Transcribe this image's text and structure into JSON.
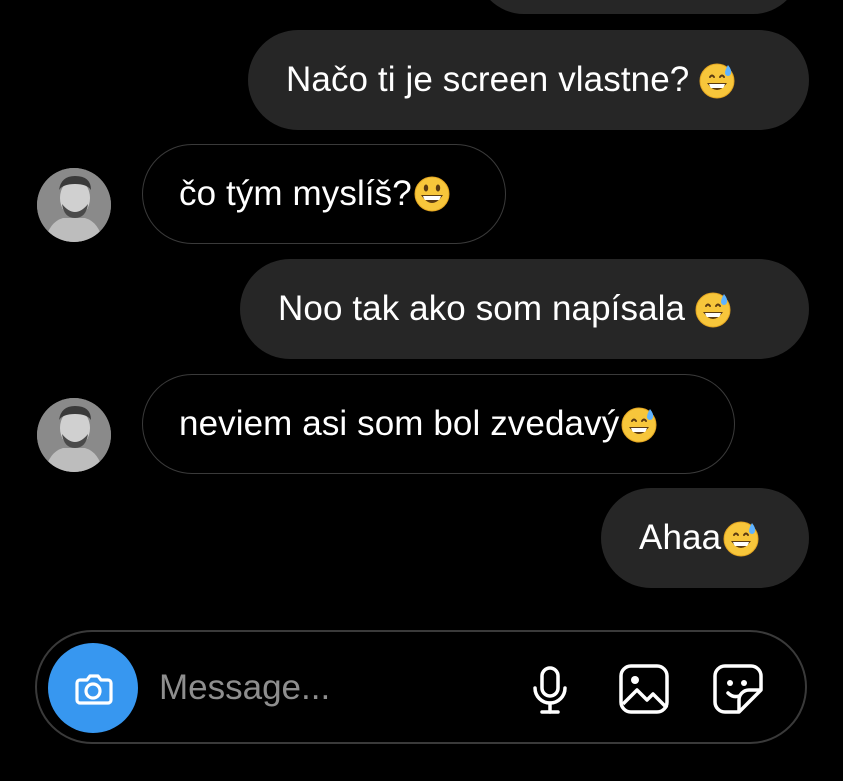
{
  "messages": [
    {
      "side": "sent",
      "text": ""
    },
    {
      "side": "sent",
      "text": "Načo ti je screen vlastne?",
      "emoji": "grinning-sweat-emoji"
    },
    {
      "side": "received",
      "text": "čo tým myslíš?",
      "emoji": "grinning-emoji"
    },
    {
      "side": "sent",
      "text": "Noo tak ako som napísala",
      "emoji": "grinning-sweat-emoji"
    },
    {
      "side": "received",
      "text": "neviem asi som bol zvedavý",
      "emoji": "grinning-sweat-emoji"
    },
    {
      "side": "sent",
      "text": "Ahaa",
      "emoji": "grinning-sweat-emoji"
    }
  ],
  "composer": {
    "placeholder": "Message...",
    "icons": [
      "camera-icon",
      "microphone-icon",
      "image-icon",
      "sticker-icon"
    ]
  },
  "colors": {
    "background": "#000000",
    "sent_bubble": "#262626",
    "received_border": "#3a3a3a",
    "accent": "#3797f0",
    "placeholder": "#8e8e8e"
  }
}
